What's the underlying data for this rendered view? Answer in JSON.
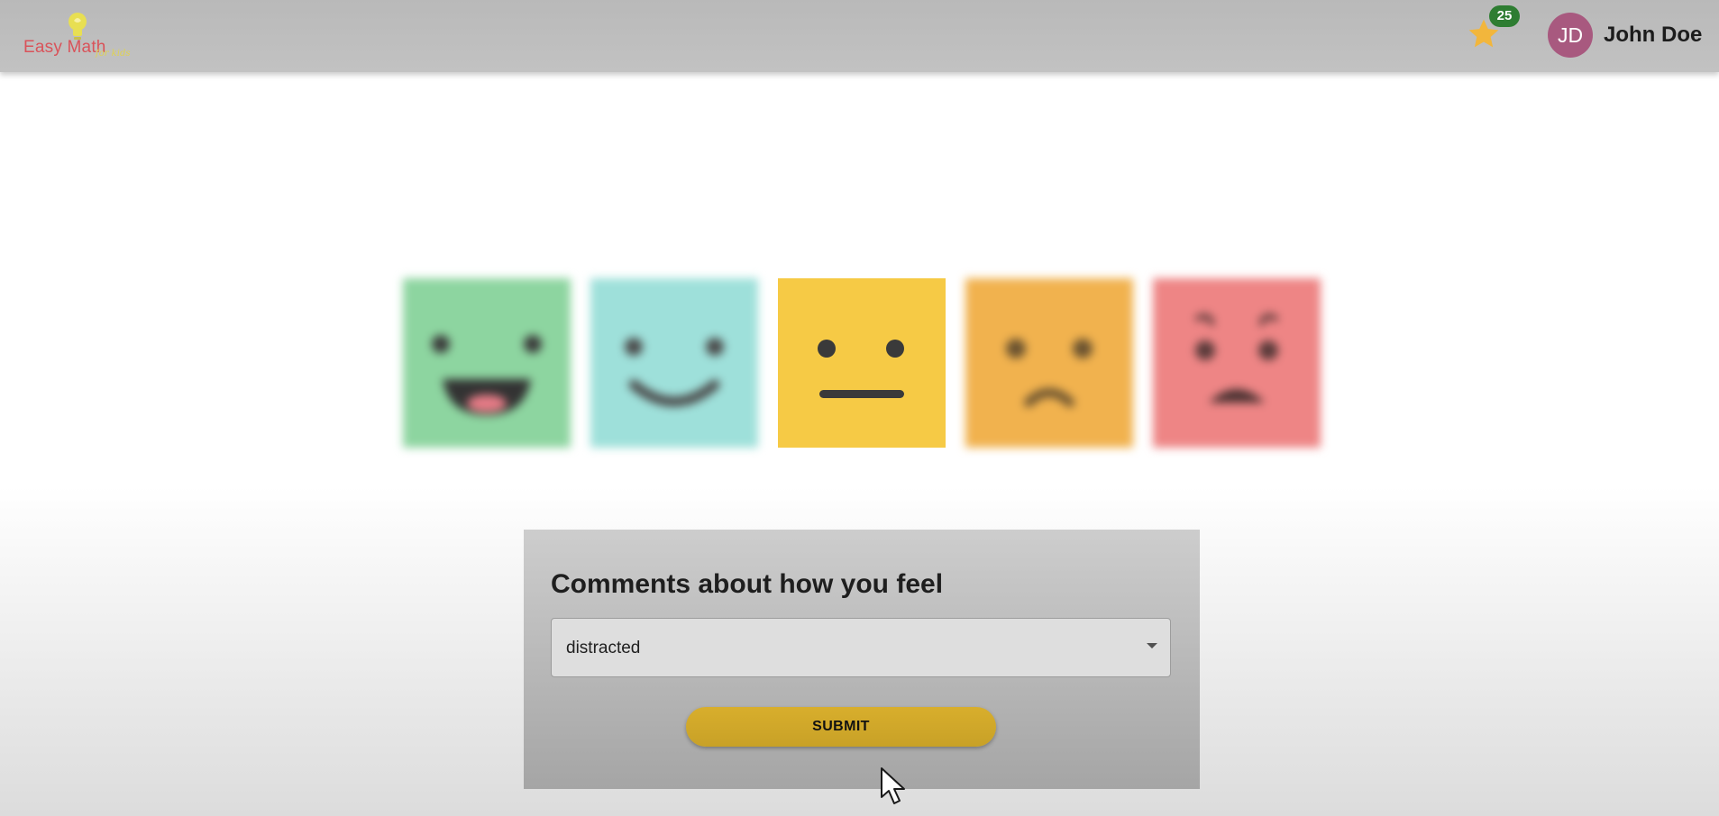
{
  "header": {
    "logo": {
      "title": "Easy Math",
      "subtitle": "for kids",
      "icon": "lightbulb-icon"
    },
    "stars": {
      "icon": "star-icon",
      "count": "25"
    },
    "user": {
      "initials": "JD",
      "name": "John Doe"
    }
  },
  "moods": [
    {
      "name": "very-happy",
      "color": "#8dd5a0",
      "selected": false
    },
    {
      "name": "happy",
      "color": "#9ee0da",
      "selected": false
    },
    {
      "name": "neutral",
      "color": "#f6ca45",
      "selected": true
    },
    {
      "name": "sad",
      "color": "#f1b24e",
      "selected": false
    },
    {
      "name": "upset",
      "color": "#ee8585",
      "selected": false
    }
  ],
  "comments": {
    "title": "Comments about how you feel",
    "selected_value": "distracted",
    "submit_label": "SUBMIT"
  },
  "colors": {
    "header_bg": "#bdbdbd",
    "badge_bg": "#2e7d32",
    "avatar_bg": "#a8597f",
    "star": "#f2b63c",
    "submit_bg": "#d1a72a"
  }
}
